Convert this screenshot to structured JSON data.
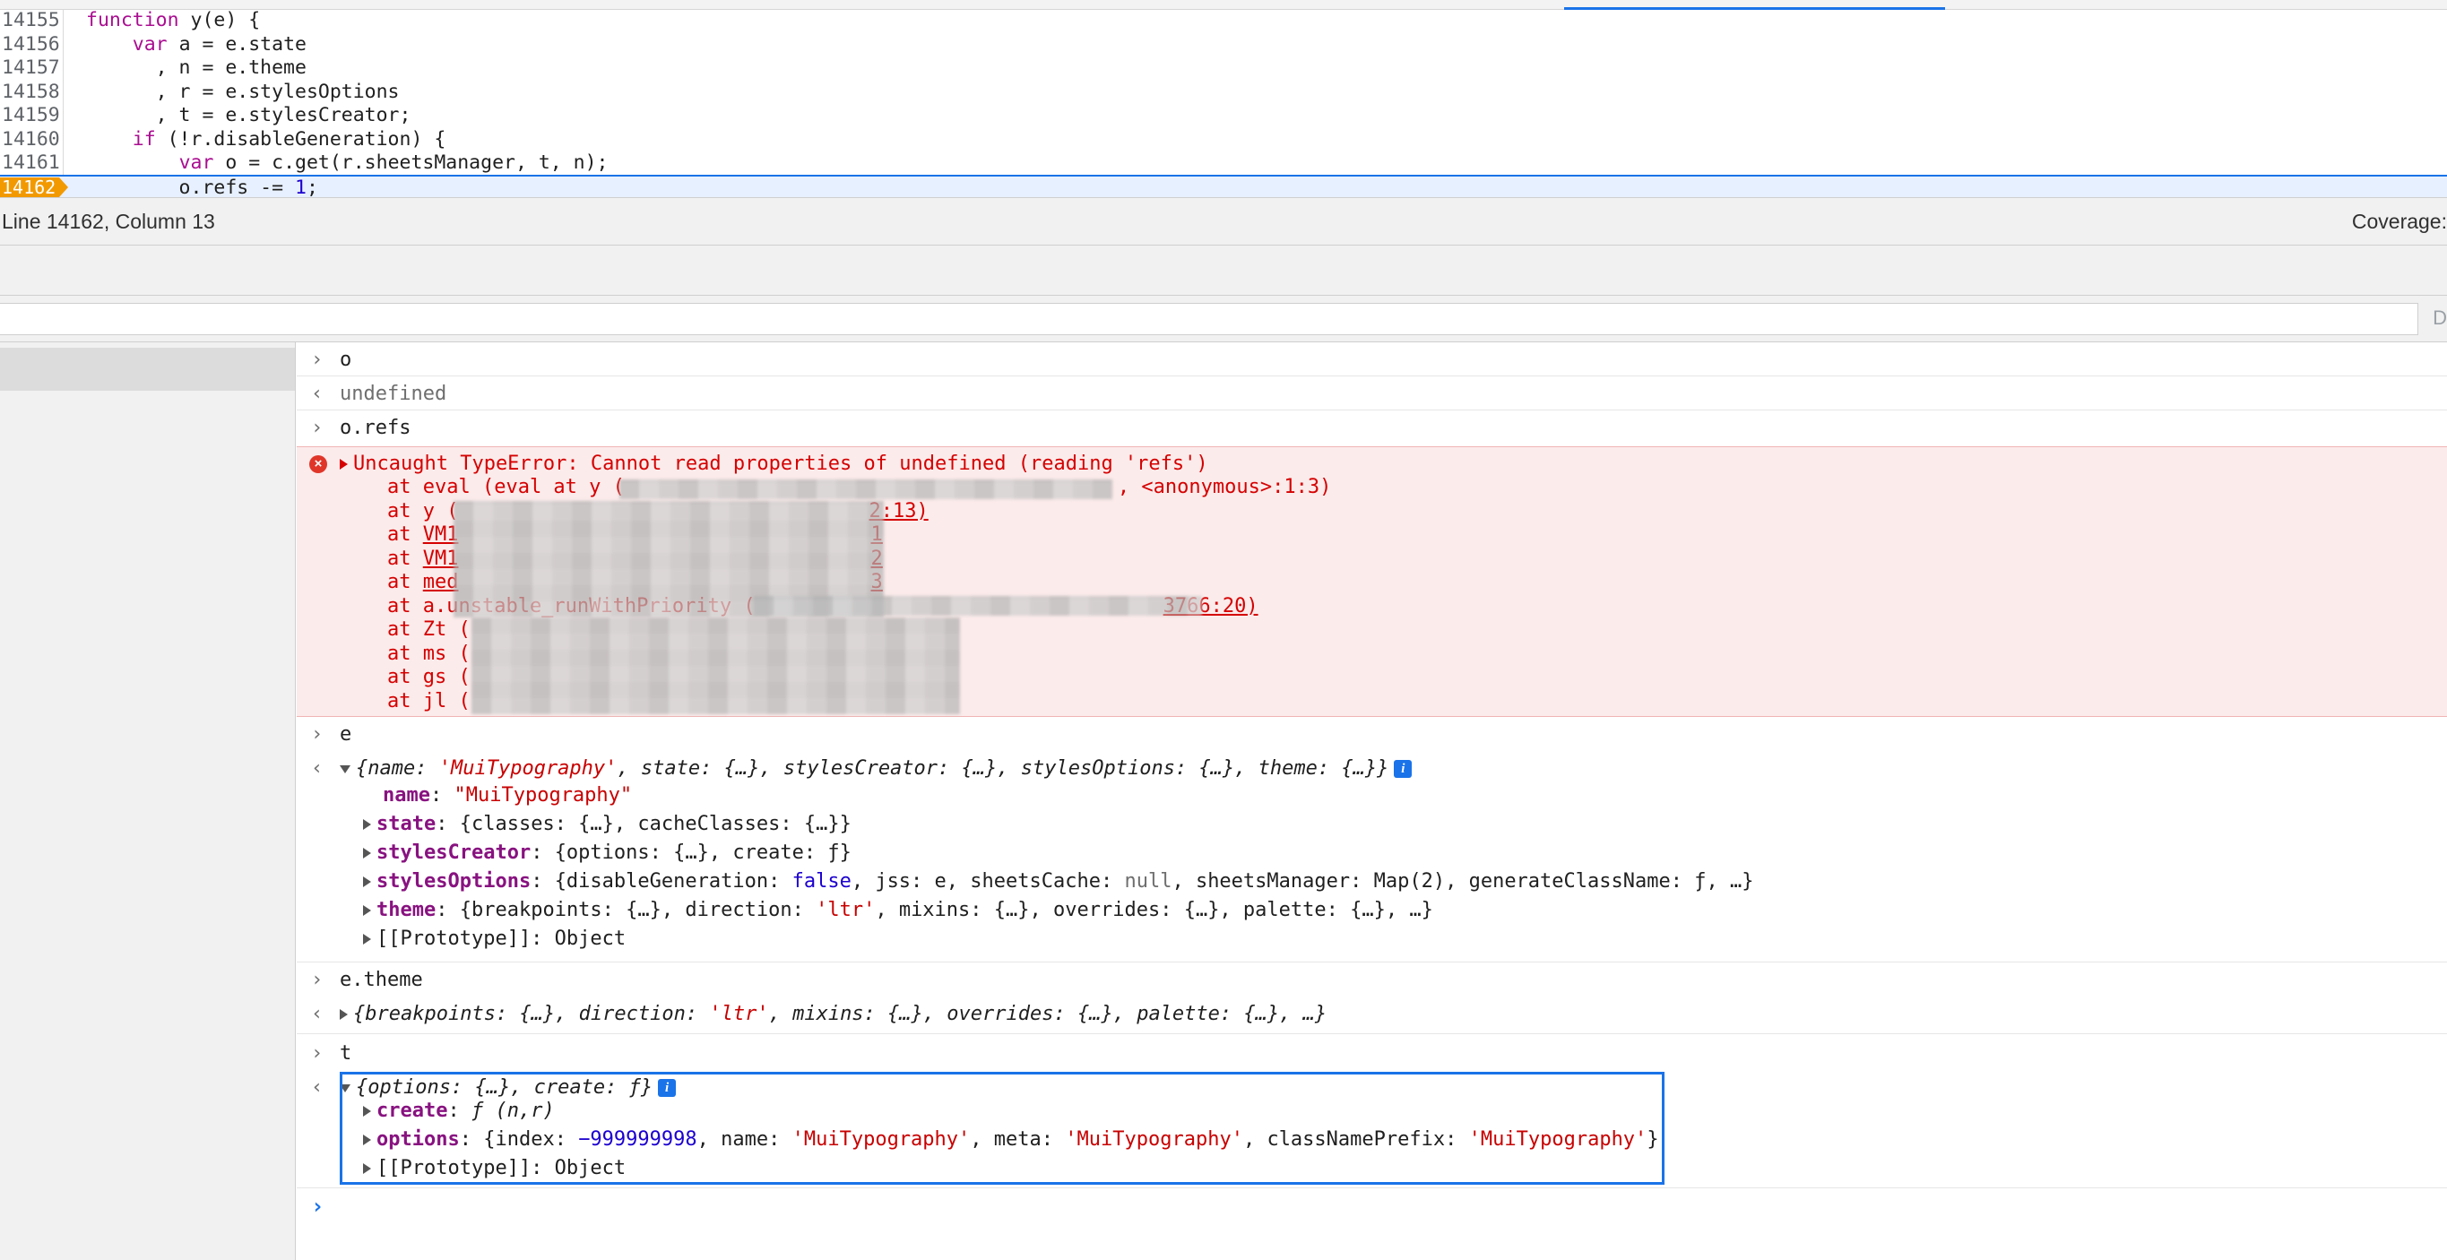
{
  "editor": {
    "lines": [
      {
        "no": "14155",
        "code": "function y(e) {"
      },
      {
        "no": "14156",
        "code": "    var a = e.state"
      },
      {
        "no": "14157",
        "code": "      , n = e.theme"
      },
      {
        "no": "14158",
        "code": "      , r = e.stylesOptions"
      },
      {
        "no": "14159",
        "code": "      , t = e.stylesCreator;"
      },
      {
        "no": "14160",
        "code": "    if (!r.disableGeneration) {"
      },
      {
        "no": "14161",
        "code": "        var o = c.get(r.sheetsManager, t, n);"
      },
      {
        "no": "14162",
        "code": "        o.refs -= 1;"
      }
    ],
    "paused_line": "14162"
  },
  "status_bar": {
    "cursor": "Line 14162, Column 13",
    "coverage": "Coverage:"
  },
  "filter": {
    "placeholder": "",
    "edge_label": "D"
  },
  "console": {
    "entries": [
      {
        "type": "input",
        "text": "o"
      },
      {
        "type": "result",
        "text": "undefined"
      },
      {
        "type": "input",
        "text": "o.refs"
      }
    ],
    "error": {
      "message": "Uncaught TypeError: Cannot read properties of undefined (reading 'refs')",
      "stack": [
        {
          "fn": "at eval (eval at y (",
          "tail": ", <anonymous>:1:3)"
        },
        {
          "fn": "at y (",
          "tail": "2:13)"
        },
        {
          "fn": "at ",
          "link": "VM1",
          "tail": "1"
        },
        {
          "fn": "at ",
          "link": "VM1",
          "tail": "2"
        },
        {
          "fn": "at ",
          "link": "med",
          "tail": "3"
        },
        {
          "fn": "at a.unstable_runWithPriority (",
          "tail": "3766:20)"
        },
        {
          "fn": "at Zt (",
          "tail": ""
        },
        {
          "fn": "at ms (",
          "tail": ""
        },
        {
          "fn": "at gs (",
          "tail": ""
        },
        {
          "fn": "at jl (",
          "tail": ""
        }
      ]
    },
    "e_input": "e",
    "e_summary": {
      "open": "{",
      "k1": "name",
      "v1": "'MuiTypography'",
      "rest": ", state: {…}, stylesCreator: {…}, stylesOptions: {…}, theme: {…}}"
    },
    "e_props": {
      "name_key": "name",
      "name_val": "\"MuiTypography\"",
      "state_key": "state",
      "state_val": "{classes: {…}, cacheClasses: {…}}",
      "creator_key": "stylesCreator",
      "creator_val": "{options: {…}, create: ƒ}",
      "opts_key": "stylesOptions",
      "opts_pre": "{disableGeneration: ",
      "opts_false": "false",
      "opts_mid": ", jss: e, sheetsCache: ",
      "opts_null": "null",
      "opts_post": ", sheetsManager: Map(2), generateClassName: ƒ, …}",
      "theme_key": "theme",
      "theme_pre": "{breakpoints: {…}, direction: ",
      "theme_ltr": "'ltr'",
      "theme_post": ", mixins: {…}, overrides: {…}, palette: {…}, …}",
      "proto": "[[Prototype]]: Object"
    },
    "theme_input": "e.theme",
    "theme_summary": {
      "pre": "{breakpoints: {…}, direction: ",
      "ltr": "'ltr'",
      "post": ", mixins: {…}, overrides: {…}, palette: {…}, …}"
    },
    "t_input": "t",
    "t_summary": "{options: {…}, create: ƒ}",
    "t_props": {
      "create_key": "create",
      "create_val": "ƒ (n,r)",
      "options_key": "options",
      "options_pre": "{index: ",
      "options_index": "−999999998",
      "options_mid1": ", name: ",
      "options_name": "'MuiTypography'",
      "options_mid2": ", meta: ",
      "options_meta": "'MuiTypography'",
      "options_mid3": ", classNamePrefix: ",
      "options_prefix": "'MuiTypography'",
      "options_close": "}",
      "proto": "[[Prototype]]: Object"
    }
  },
  "colors": {
    "accent": "#1a73e8",
    "error_bg": "#fcebeb",
    "error_text": "#d50000",
    "paused_marker": "#f29900"
  }
}
